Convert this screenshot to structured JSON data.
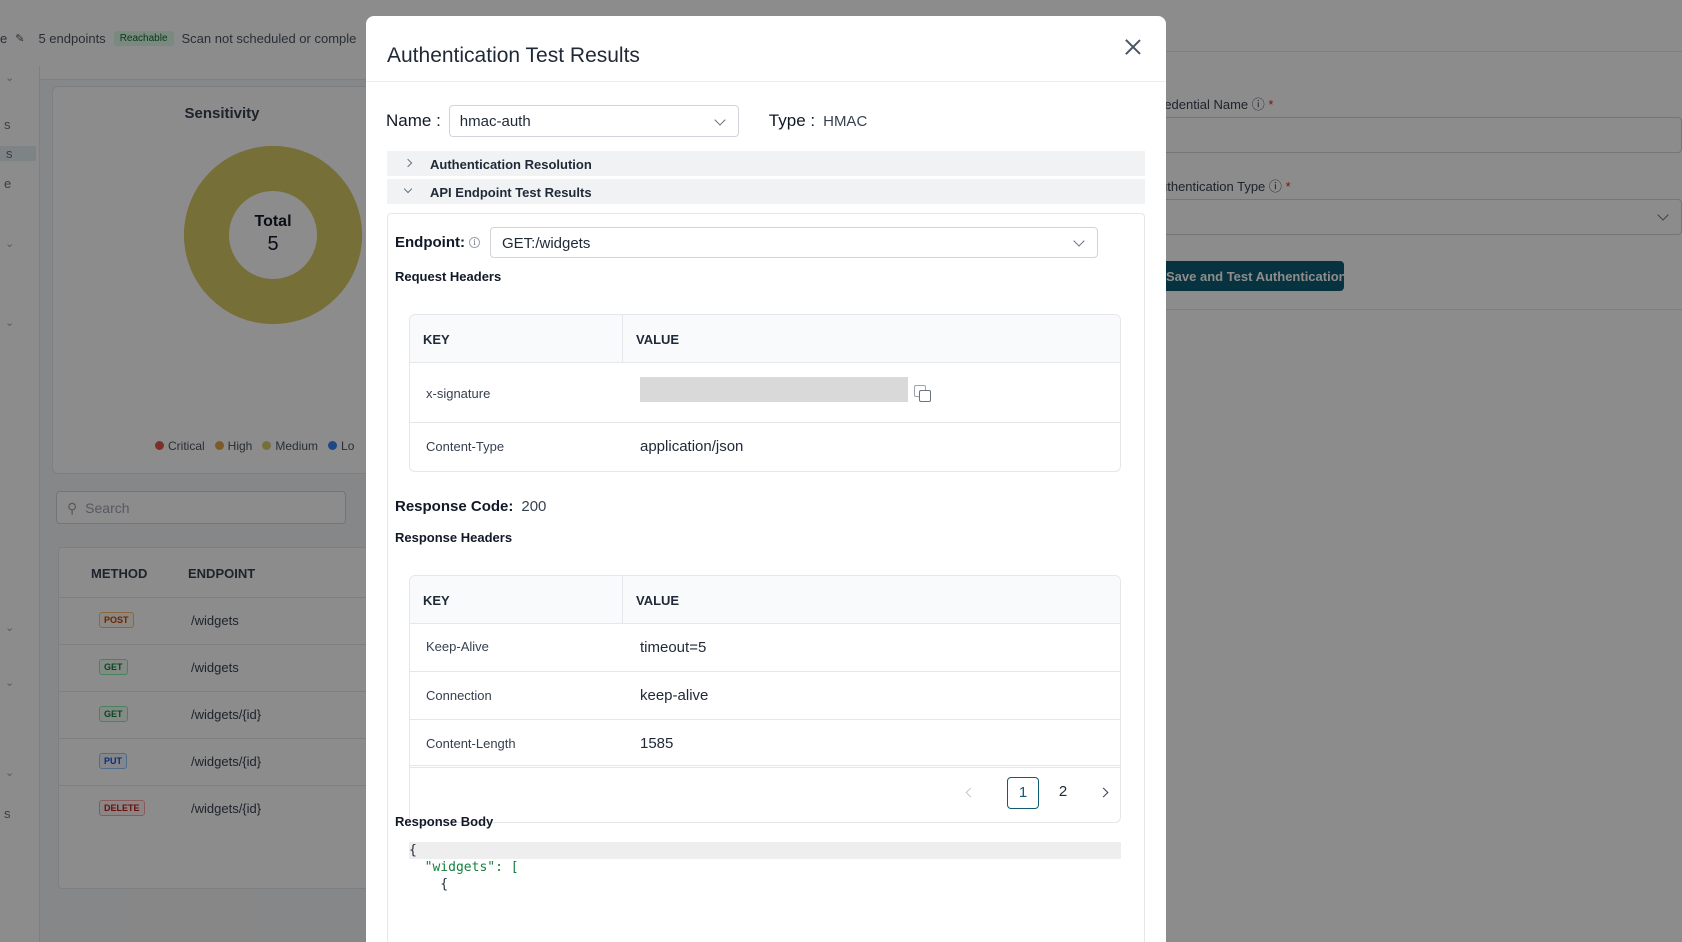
{
  "background": {
    "meta_text_prefix": "e",
    "endpoint_count": "5 endpoints",
    "reachable_badge": "Reachable",
    "scan_status": "Scan not scheduled or comple",
    "left_rail_letters": [
      "s",
      "s",
      "e",
      "s"
    ],
    "sensitivity_title": "Sensitivity",
    "donut_total_label": "Total",
    "donut_total_value": "5",
    "legend": [
      {
        "label": "Critical",
        "color": "#e05a4e"
      },
      {
        "label": "High",
        "color": "#e0a84a"
      },
      {
        "label": "Medium",
        "color": "#d9cb67"
      },
      {
        "label": "Lo",
        "color": "#3b82f6"
      }
    ],
    "search_placeholder": "Search",
    "table_headers": {
      "method": "METHOD",
      "endpoint": "ENDPOINT"
    },
    "rows": [
      {
        "method": "POST",
        "path": "/widgets"
      },
      {
        "method": "GET",
        "path": "/widgets"
      },
      {
        "method": "GET",
        "path": "/widgets/{id}"
      },
      {
        "method": "PUT",
        "path": "/widgets/{id}"
      },
      {
        "method": "DELETE",
        "path": "/widgets/{id}"
      }
    ],
    "credential_name_label": "redential Name",
    "auth_type_label": "uthentication Type",
    "save_button": "Save and Test Authentication"
  },
  "modal": {
    "title": "Authentication Test Results",
    "name_label": "Name :",
    "name_value": "hmac-auth",
    "type_label": "Type :",
    "type_value": "HMAC",
    "accordion": {
      "auth_resolution": "Authentication Resolution",
      "endpoint_results": "API Endpoint Test Results"
    },
    "endpoint_label": "Endpoint:",
    "endpoint_value": "GET:/widgets",
    "request_headers_title": "Request Headers",
    "table_headers": {
      "key": "KEY",
      "value": "VALUE"
    },
    "request_headers": [
      {
        "key": "x-signature",
        "value": ""
      },
      {
        "key": "Content-Type",
        "value": "application/json"
      }
    ],
    "response_code_label": "Response Code:",
    "response_code_value": "200",
    "response_headers_title": "Response Headers",
    "response_headers": [
      {
        "key": "Keep-Alive",
        "value": "timeout=5"
      },
      {
        "key": "Connection",
        "value": "keep-alive"
      },
      {
        "key": "Content-Length",
        "value": "1585"
      }
    ],
    "pagination": {
      "pages": [
        "1",
        "2"
      ],
      "current": "1"
    },
    "response_body_title": "Response Body",
    "response_body_lines": [
      "{",
      "  \"widgets\": [",
      "    {"
    ]
  }
}
